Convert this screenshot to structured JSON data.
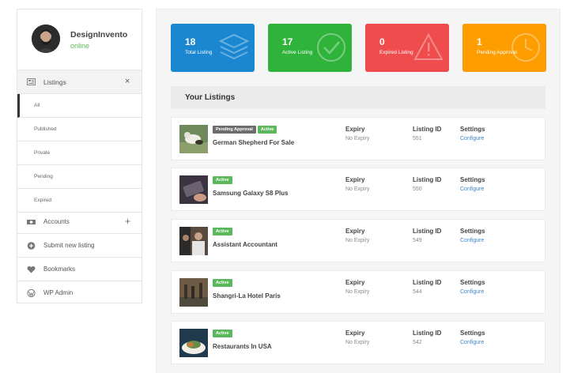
{
  "profile": {
    "name": "DesignInvento",
    "status": "online"
  },
  "sidebar": {
    "listings": {
      "label": "Listings",
      "close": "×"
    },
    "sub_items": [
      {
        "label": "All"
      },
      {
        "label": "Published"
      },
      {
        "label": "Private"
      },
      {
        "label": "Pending"
      },
      {
        "label": "Expired"
      }
    ],
    "items": [
      {
        "label": "Accounts",
        "icon": "money-icon",
        "plus": "+"
      },
      {
        "label": "Submit new listing",
        "icon": "plus-circle-icon"
      },
      {
        "label": "Bookmarks",
        "icon": "heart-icon"
      },
      {
        "label": "WP Admin",
        "icon": "wordpress-icon"
      }
    ]
  },
  "stats": [
    {
      "value": "18",
      "label": "Total Listing",
      "color": "#1a87d0",
      "icon": "layers-icon"
    },
    {
      "value": "17",
      "label": "Active Listing",
      "color": "#2fb33b",
      "icon": "check-circle-icon"
    },
    {
      "value": "0",
      "label": "Expired Listing",
      "color": "#ef4d4d",
      "icon": "warning-icon"
    },
    {
      "value": "1",
      "label": "Pending Approval",
      "color": "#fd9d00",
      "icon": "clock-icon"
    }
  ],
  "section_title": "Your Listings",
  "columns": {
    "expiry": "Expiry",
    "listing_id": "Listing ID",
    "settings": "Settings"
  },
  "listings": [
    {
      "title": "German Shepherd For Sale",
      "badges": [
        "Pending Approval",
        "Active"
      ],
      "expiry": "No Expiry",
      "id": "551",
      "settings": "Configure"
    },
    {
      "title": "Samsung Galaxy S8 Plus",
      "badges": [
        "Active"
      ],
      "expiry": "No Expiry",
      "id": "550",
      "settings": "Configure"
    },
    {
      "title": "Assistant Accountant",
      "badges": [
        "Active"
      ],
      "expiry": "No Expiry",
      "id": "549",
      "settings": "Configure"
    },
    {
      "title": "Shangri-La Hotel Paris",
      "badges": [
        "Active"
      ],
      "expiry": "No Expiry",
      "id": "544",
      "settings": "Configure"
    },
    {
      "title": "Restaurants In USA",
      "badges": [
        "Active"
      ],
      "expiry": "No Expiry",
      "id": "542",
      "settings": "Configure"
    }
  ]
}
